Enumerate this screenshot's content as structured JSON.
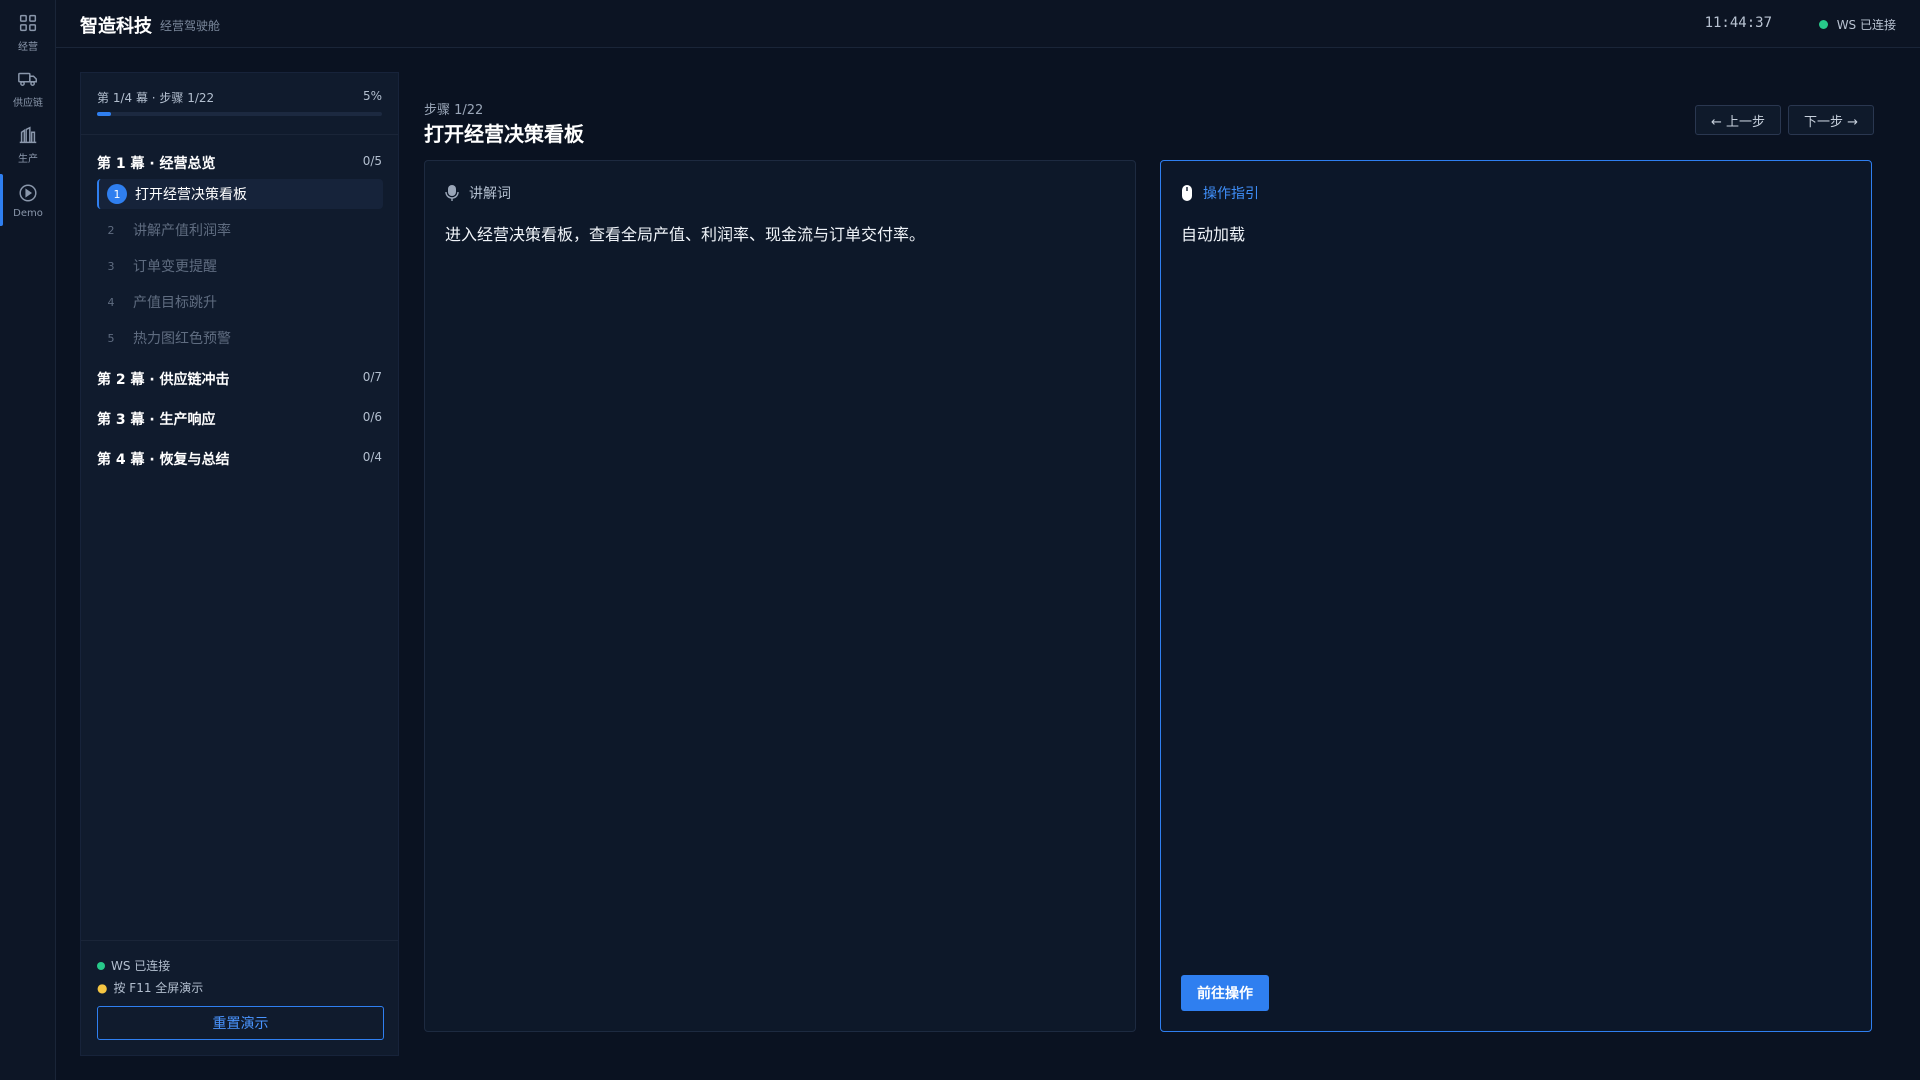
{
  "rail": {
    "items": [
      {
        "label": "经营",
        "icon": "grid-icon"
      },
      {
        "label": "供应链",
        "icon": "truck-icon"
      },
      {
        "label": "生产",
        "icon": "factory-icon"
      },
      {
        "label": "Demo",
        "icon": "play-circle-icon",
        "active": true
      }
    ]
  },
  "header": {
    "brand": "智造科技",
    "subtitle": "经营驾驶舱",
    "clock": "11:44:37",
    "ws_status": "WS 已连接"
  },
  "steps_panel": {
    "progress_text": "第 1/4 幕 · 步骤 1/22",
    "progress_percent": "5%",
    "progress_value": 0.05,
    "acts": [
      {
        "title": "第 1 幕 · 经营总览",
        "count": "0/5",
        "steps": [
          {
            "num": "1",
            "label": "打开经营决策看板",
            "active": true
          },
          {
            "num": "2",
            "label": "讲解产值利润率"
          },
          {
            "num": "3",
            "label": "订单变更提醒"
          },
          {
            "num": "4",
            "label": "产值目标跳升"
          },
          {
            "num": "5",
            "label": "热力图红色预警"
          }
        ]
      },
      {
        "title": "第 2 幕 · 供应链冲击",
        "count": "0/7"
      },
      {
        "title": "第 3 幕 · 生产响应",
        "count": "0/6"
      },
      {
        "title": "第 4 幕 · 恢复与总结",
        "count": "0/4"
      }
    ],
    "footer": {
      "ws_status": "WS 已连接",
      "hint": "按 F11 全屏演示",
      "reset_label": "重置演示"
    }
  },
  "main": {
    "step_label": "步骤 1/22",
    "step_title": "打开经营决策看板",
    "prev_label": "← 上一步",
    "next_label": "下一步 →",
    "script_card": {
      "title": "讲解词",
      "body": "进入经营决策看板，查看全局产值、利润率、现金流与订单交付率。"
    },
    "guide_card": {
      "title": "操作指引",
      "body": "自动加载",
      "action_label": "前往操作"
    }
  },
  "colors": {
    "accent": "#2f7ff0",
    "status_ok": "#27c98a",
    "background": "#0a1221"
  }
}
